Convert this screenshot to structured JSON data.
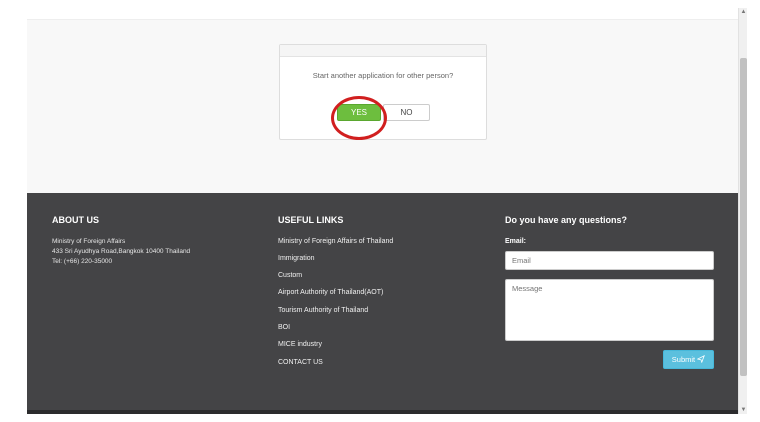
{
  "dialog": {
    "question": "Start another application for other person?",
    "yes_label": "YES",
    "no_label": "NO"
  },
  "footer": {
    "about": {
      "title": "ABOUT US",
      "lines": [
        "Ministry of Foreign Affairs",
        "433 Sri Ayudhya Road,Bangkok 10400 Thailand",
        "Tel: (+66) 220-35000"
      ]
    },
    "links": {
      "title": "USEFUL LINKS",
      "items": [
        "Ministry of Foreign Affairs of Thailand",
        "Immigration",
        "Custom",
        "Airport Authority of Thailand(AOT)",
        "Tourism Authority of Thailand",
        "BOI",
        "MICE industry",
        "CONTACT US"
      ]
    },
    "contact": {
      "title": "Do you have any questions?",
      "email_label": "Email:",
      "email_placeholder": "Email",
      "message_placeholder": "Message",
      "submit_label": "Submit",
      "submit_icon": "paper-plane-icon"
    }
  },
  "colors": {
    "yes_button": "#6dbe3e",
    "footer_bg": "#444446",
    "submit_button": "#5bc0de",
    "annotation": "#d11f1f"
  }
}
